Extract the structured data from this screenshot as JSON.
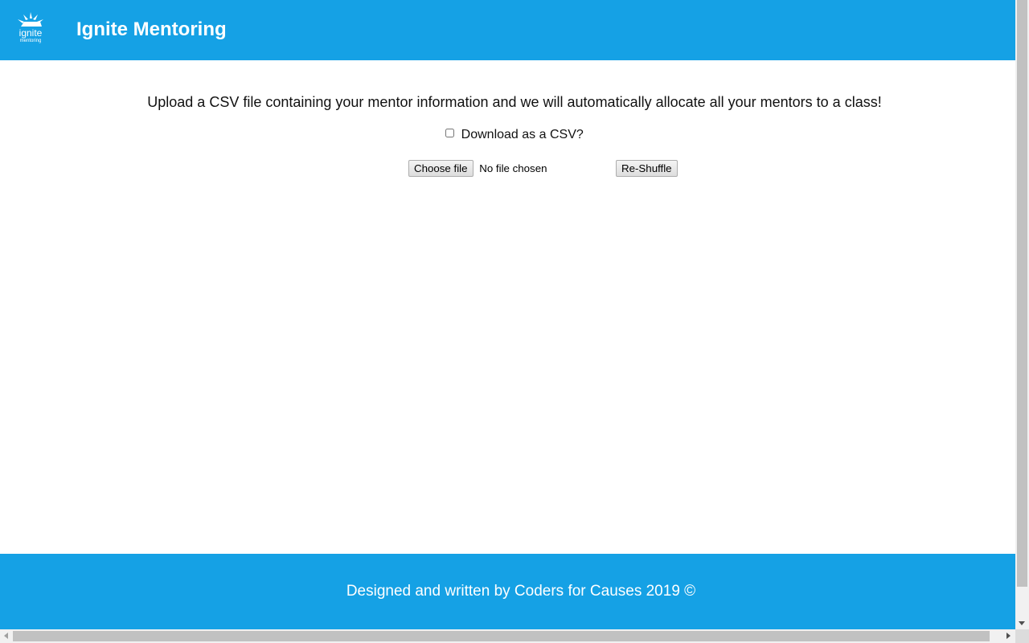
{
  "header": {
    "title": "Ignite Mentoring",
    "logo": {
      "icon": "spark-logo-icon",
      "word": "ignite",
      "subword": "mentoring"
    }
  },
  "main": {
    "intro_text": "Upload a CSV file containing your mentor information and we will automatically allocate all your mentors to a class!",
    "download_csv": {
      "label": "Download as a CSV?",
      "checked": false
    },
    "file_input": {
      "button_label": "Choose file",
      "status_text": "No file chosen"
    },
    "reshuffle_label": "Re-Shuffle"
  },
  "footer": {
    "text": "Designed and written by Coders for Causes 2019 ©"
  },
  "colors": {
    "brand": "#15a1e5",
    "text": "#111111",
    "on_brand_text": "#ffffff"
  }
}
